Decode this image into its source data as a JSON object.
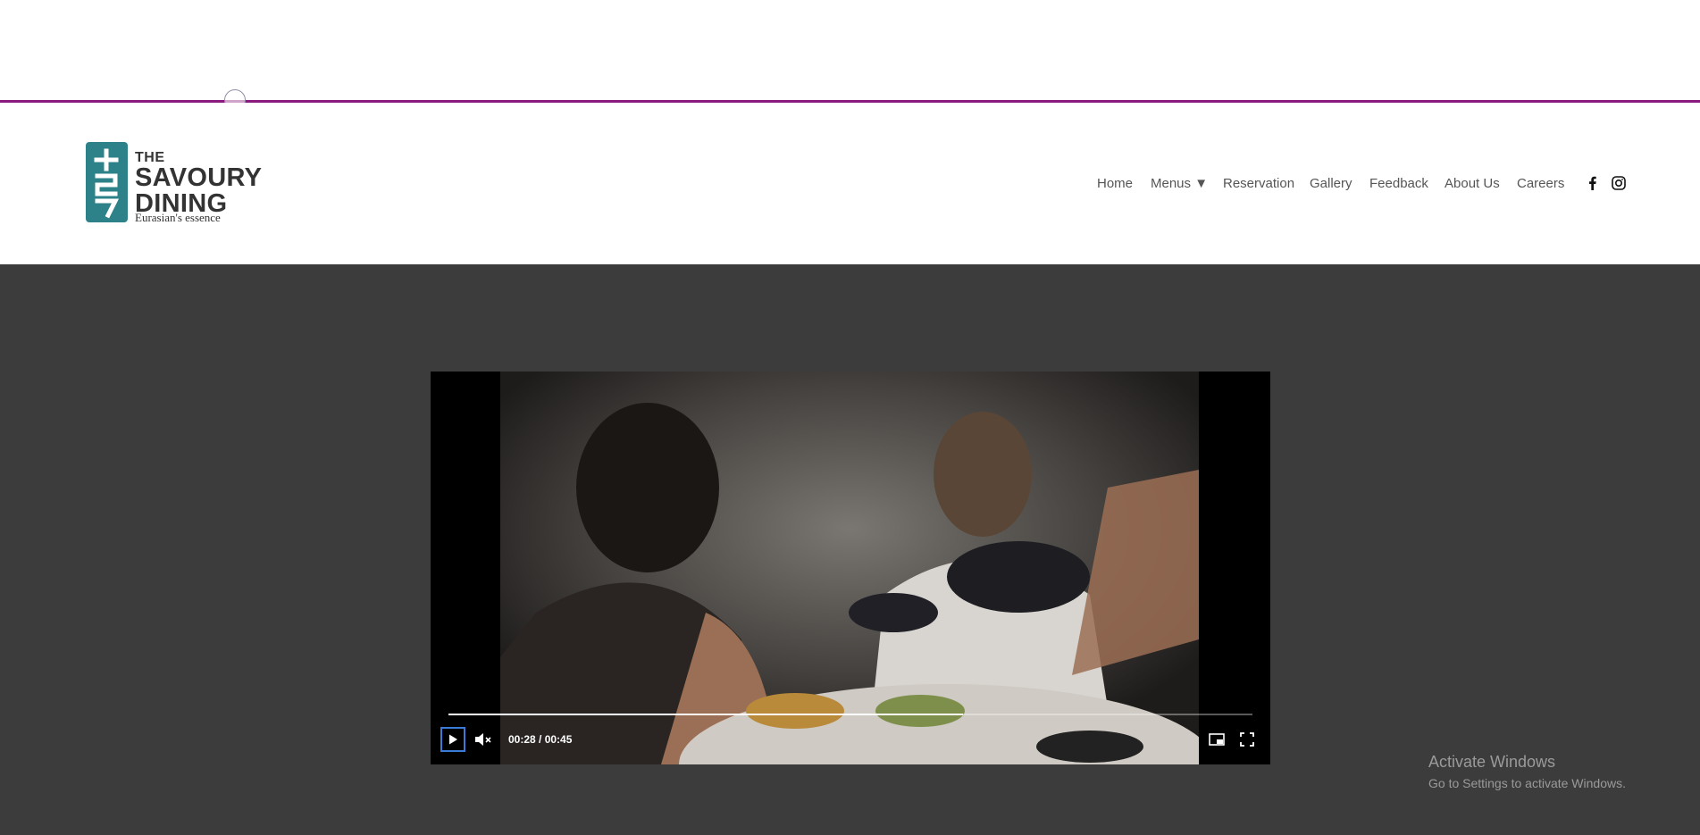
{
  "brand": {
    "line1": "THE",
    "line2": "SAVOURY",
    "line3": "DINING",
    "tagline": "Eurasian's essence",
    "logo_color": "#2c8288"
  },
  "nav": {
    "items": [
      "Home",
      "Menus ▼",
      "Reservation",
      "Gallery",
      "Feedback",
      "About Us",
      "Careers"
    ],
    "social": [
      "facebook-icon",
      "instagram-icon"
    ]
  },
  "accent_line_color": "#8b1a7e",
  "video": {
    "time": "00:28 / 00:45",
    "progress": 0.64,
    "controls": [
      "play-icon",
      "muted-volume-icon",
      "picture-in-picture-icon",
      "fullscreen-icon"
    ]
  },
  "os_watermark": {
    "title": "Activate Windows",
    "subtitle": "Go to Settings to activate Windows."
  }
}
